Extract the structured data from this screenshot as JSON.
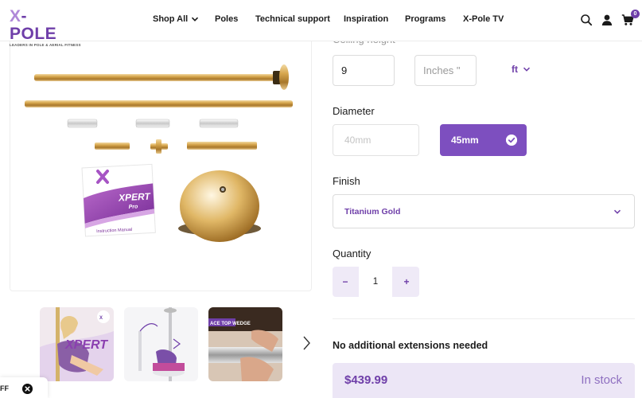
{
  "brand": {
    "name_prefix": "X",
    "name_rest": "-POLE",
    "tagline": "LEADERS IN POLE & AERIAL FITNESS"
  },
  "nav": {
    "items": [
      {
        "label": "Shop All",
        "has_dropdown": true
      },
      {
        "label": "Poles"
      },
      {
        "label": "Technical support"
      },
      {
        "label": "Inspiration"
      },
      {
        "label": "Programs"
      },
      {
        "label": "X-Pole TV"
      }
    ],
    "cart_count": "0",
    "icons": [
      "search-icon",
      "account-icon",
      "cart-icon"
    ]
  },
  "gallery": {
    "main_image": "xpert-pro-pole-kit-gold",
    "manual_brand": "XPERT",
    "manual_sub": "Pro",
    "manual_title": "Instruction Manual",
    "thumbnails": [
      "performer-thumbnail",
      "pole-assembly-thumbnail",
      "top-mount-thumbnail"
    ],
    "next_icon": "chevron-right-icon"
  },
  "options": {
    "ceiling_height_label": "Ceiling height",
    "height_value": "9",
    "inches_placeholder": "Inches \"",
    "unit_value": "ft",
    "diameter_label": "Diameter",
    "diameter_options": [
      {
        "label": "40mm",
        "state": "disabled"
      },
      {
        "label": "45mm",
        "state": "selected"
      }
    ],
    "finish_label": "Finish",
    "finish_value": "Titanium Gold",
    "quantity_label": "Quantity",
    "quantity_minus": "−",
    "quantity_value": "1",
    "quantity_plus": "+",
    "extension_note": "No additional extensions needed"
  },
  "purchase": {
    "price": "$439.99",
    "stock_status": "In stock"
  },
  "cookie": {
    "text": "FF"
  },
  "colors": {
    "accent": "#6f3fa9",
    "accent_button": "#7d4fbf",
    "accent_soft": "#ece6f6",
    "gold": "#c99a3a"
  }
}
